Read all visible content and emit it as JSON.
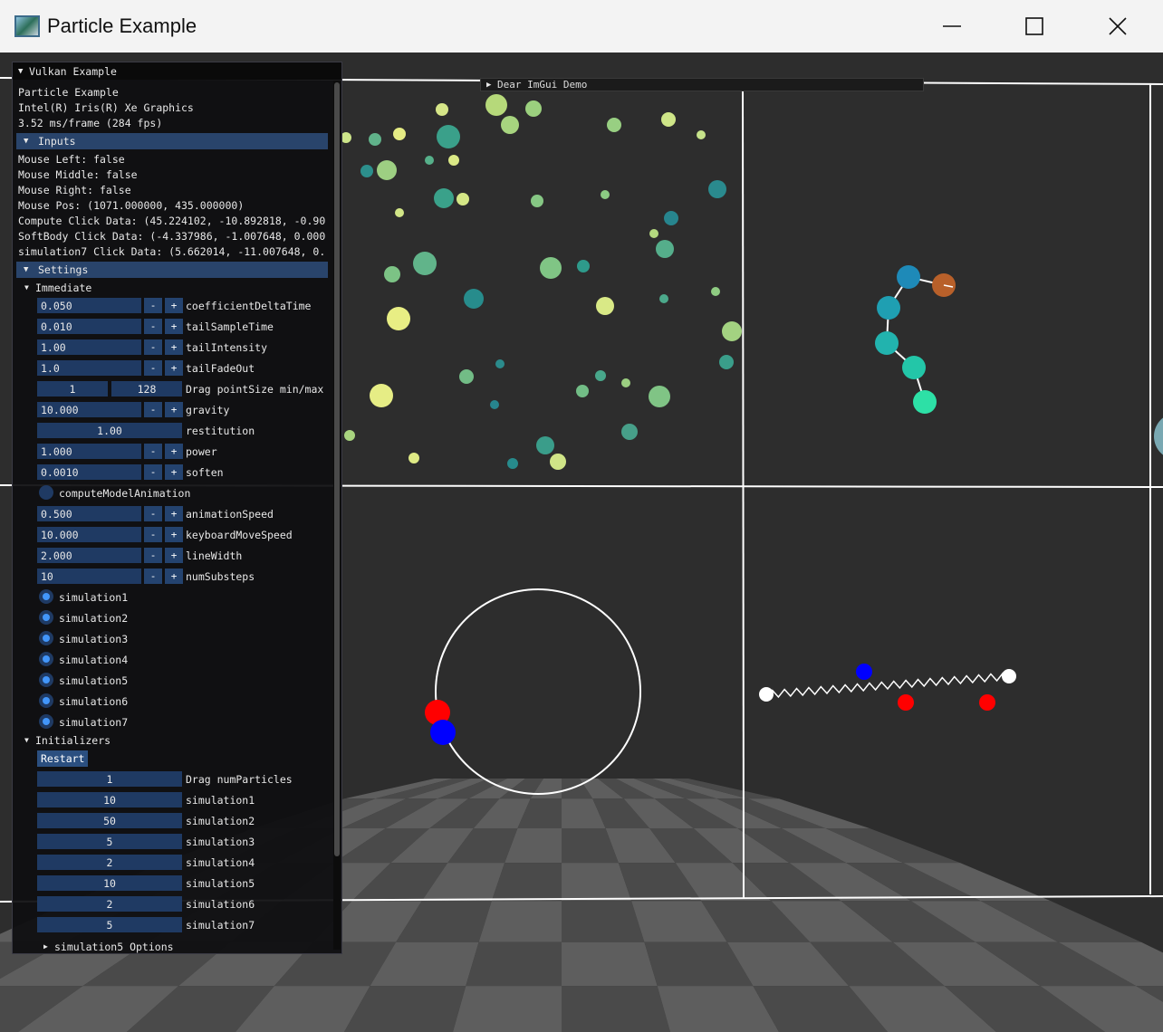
{
  "window": {
    "title": "Particle Example",
    "minimize_icon": "minimize-icon",
    "maximize_icon": "maximize-icon",
    "close_icon": "close-icon"
  },
  "demo_window": {
    "label": "Dear ImGui Demo"
  },
  "panel": {
    "title": "Vulkan Example",
    "info": [
      "Particle Example",
      "Intel(R) Iris(R) Xe Graphics",
      "3.52 ms/frame (284 fps)"
    ],
    "inputs": {
      "header": "Inputs",
      "lines": [
        "Mouse Left: false",
        "Mouse Middle: false",
        "Mouse Right: false",
        "Mouse Pos: (1071.000000, 435.000000)",
        "Compute Click Data: (45.224102, -10.892818, -0.90",
        "SoftBody Click Data: (-4.337986, -1.007648, 0.000",
        "simulation7 Click Data: (5.662014, -11.007648, 0."
      ]
    },
    "settings": {
      "header": "Settings",
      "immediate": {
        "header": "Immediate",
        "stepper_rows1": [
          {
            "value": "0.050",
            "label": "coefficientDeltaTime"
          },
          {
            "value": "0.010",
            "label": "tailSampleTime"
          },
          {
            "value": "1.00",
            "label": "tailIntensity"
          },
          {
            "value": "1.0",
            "label": "tailFadeOut"
          }
        ],
        "point_size": {
          "min": "1",
          "max": "128",
          "label": "Drag pointSize min/max"
        },
        "gravity": {
          "value": "10.000",
          "label": "gravity"
        },
        "restitution": {
          "value": "1.00",
          "label": "restitution"
        },
        "stepper_rows2": [
          {
            "value": "1.000",
            "label": "power"
          },
          {
            "value": "0.0010",
            "label": "soften"
          }
        ],
        "compute_model_animation": "computeModelAnimation",
        "stepper_rows3": [
          {
            "value": "0.500",
            "label": "animationSpeed"
          },
          {
            "value": "10.000",
            "label": "keyboardMoveSpeed"
          },
          {
            "value": "2.000",
            "label": "lineWidth"
          },
          {
            "value": "10",
            "label": "numSubsteps"
          }
        ],
        "simulations": [
          "simulation1",
          "simulation2",
          "simulation3",
          "simulation4",
          "simulation5",
          "simulation6",
          "simulation7"
        ]
      },
      "initializers": {
        "header": "Initializers",
        "restart_label": "Restart",
        "num_particles": {
          "value": "1",
          "label": "Drag numParticles"
        },
        "sims": [
          {
            "value": "10",
            "label": "simulation1"
          },
          {
            "value": "50",
            "label": "simulation2"
          },
          {
            "value": "5",
            "label": "simulation3"
          },
          {
            "value": "2",
            "label": "simulation4"
          },
          {
            "value": "10",
            "label": "simulation5"
          },
          {
            "value": "2",
            "label": "simulation6"
          },
          {
            "value": "5",
            "label": "simulation7"
          }
        ]
      },
      "sim5_options": "simulation5 Options"
    },
    "minus_label": "-",
    "plus_label": "+"
  },
  "colors": {
    "background": "#2d2d2d",
    "panel_bg": "#0f0f11",
    "header": "#29446b",
    "frame": "#1f3a63",
    "accent": "#4296fa",
    "red": "#ff0000",
    "blue": "#0000ff"
  }
}
